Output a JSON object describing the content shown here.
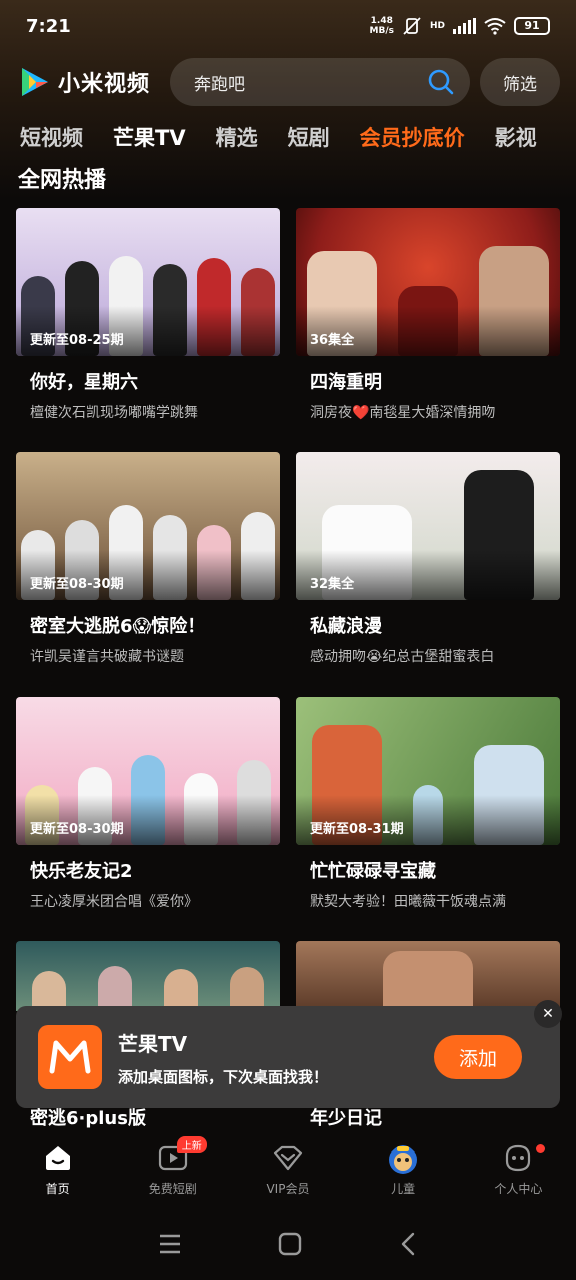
{
  "status_bar": {
    "time": "7:21",
    "speed_value": "1.48",
    "speed_unit": "MB/s",
    "network": "HD",
    "battery": "91"
  },
  "header": {
    "app_name": "小米视频",
    "search_placeholder": "奔跑吧",
    "filter_label": "筛选"
  },
  "tabs": [
    {
      "label": "短视频"
    },
    {
      "label": "芒果TV"
    },
    {
      "label": "精选"
    },
    {
      "label": "短剧"
    },
    {
      "label": "会员抄底价"
    },
    {
      "label": "影视"
    }
  ],
  "section": {
    "title": "全网热播"
  },
  "cards": [
    {
      "title": "你好，星期六",
      "subtitle": "檀健次石凯现场嘟嘴学跳舞",
      "episode": "更新至08-25期",
      "color1": "#b9a6d8",
      "color2": "#e9dff2"
    },
    {
      "title": "四海重明",
      "subtitle": "洞房夜❤️南毯星大婚深情拥吻",
      "episode": "36集全",
      "color1": "#8e1d1a",
      "color2": "#d9452b"
    },
    {
      "title": "密室大逃脱6😱惊险！",
      "subtitle": "许凯吴谨言共破藏书谜题",
      "episode": "更新至08-30期",
      "color1": "#6b5038",
      "color2": "#c9b08a"
    },
    {
      "title": "私藏浪漫",
      "subtitle": "感动拥吻😭纪总古堡甜蜜表白",
      "episode": "32集全",
      "color1": "#cfd6c8",
      "color2": "#f3ecec"
    },
    {
      "title": "快乐老友记2",
      "subtitle": "王心凌厚米团合唱《爱你》",
      "episode": "更新至08-30期",
      "color1": "#f1a8c2",
      "color2": "#f8dbe6"
    },
    {
      "title": "忙忙碌碌寻宝藏",
      "subtitle": "默契大考验！田曦薇干饭魂点满",
      "episode": "更新至08-31期",
      "color1": "#4c7a3a",
      "color2": "#9cc07a"
    },
    {
      "title": "密逃6·plus版",
      "color1": "#2f5a5c",
      "color2": "#6d8f7a"
    },
    {
      "title": "年少日记",
      "color1": "#5b3a28",
      "color2": "#a3775a"
    }
  ],
  "popup": {
    "app_name": "芒果TV",
    "message": "添加桌面图标，下次桌面找我！",
    "add_label": "添加",
    "close_glyph": "✕"
  },
  "bottom_nav": [
    {
      "label": "首页",
      "icon": "home-icon"
    },
    {
      "label": "免费短剧",
      "icon": "play-icon",
      "badge": "上新"
    },
    {
      "label": "VIP会员",
      "icon": "vip-icon"
    },
    {
      "label": "儿童",
      "icon": "kids-icon"
    },
    {
      "label": "个人中心",
      "icon": "profile-icon"
    }
  ],
  "colors": {
    "accent": "#ff6a1a",
    "background": "#0c0a09"
  }
}
